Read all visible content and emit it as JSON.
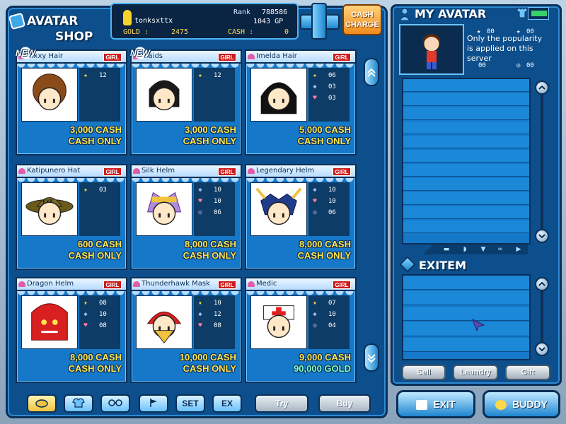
{
  "shop": {
    "title_line1": "AVATAR",
    "title_line2": "SHOP"
  },
  "info_bar": {
    "username": "tonksxttx",
    "rank_label": "Rank",
    "rank_value": "788586",
    "gp_value": "1043 GP",
    "gold_label": "GOLD :",
    "gold_value": "2475",
    "cash_label": "CASH :",
    "cash_value": "0"
  },
  "cash_charge": {
    "label_line1": "CASH",
    "label_line2": "CHARGE"
  },
  "items": [
    {
      "name": "...xxy Hair",
      "tag": "GIRL",
      "new": true,
      "stats": [
        {
          "icon": "star",
          "value": "12"
        }
      ],
      "price1": "3,000 CASH",
      "price2": "CASH ONLY"
    },
    {
      "name": "...aids",
      "tag": "GIRL",
      "new": true,
      "stats": [
        {
          "icon": "star",
          "value": "12"
        }
      ],
      "price1": "3,000 CASH",
      "price2": "CASH ONLY"
    },
    {
      "name": "Imelda Hair",
      "tag": "GIRL",
      "new": false,
      "stats": [
        {
          "icon": "star",
          "value": "06"
        },
        {
          "icon": "shield",
          "value": "03"
        },
        {
          "icon": "heart",
          "value": "03"
        }
      ],
      "price1": "5,000 CASH",
      "price2": "CASH ONLY"
    },
    {
      "name": "Katipunero Hat",
      "tag": "GIRL",
      "new": false,
      "stats": [
        {
          "icon": "star",
          "value": "03"
        }
      ],
      "price1": "600 CASH",
      "price2": "CASH ONLY"
    },
    {
      "name": "Silk Helm",
      "tag": "GIRL",
      "new": false,
      "stats": [
        {
          "icon": "shield",
          "value": "10"
        },
        {
          "icon": "heart",
          "value": "10"
        },
        {
          "icon": "swirl",
          "value": "06"
        }
      ],
      "price1": "8,000 CASH",
      "price2": "CASH ONLY"
    },
    {
      "name": "Legendary Helm",
      "tag": "GIRL",
      "new": false,
      "stats": [
        {
          "icon": "shield",
          "value": "10"
        },
        {
          "icon": "heart",
          "value": "10"
        },
        {
          "icon": "swirl",
          "value": "06"
        }
      ],
      "price1": "8,000 CASH",
      "price2": "CASH ONLY"
    },
    {
      "name": "Dragon Helm",
      "tag": "GIRL",
      "new": false,
      "stats": [
        {
          "icon": "star",
          "value": "08"
        },
        {
          "icon": "shield",
          "value": "10"
        },
        {
          "icon": "heart",
          "value": "08"
        }
      ],
      "price1": "8,000 CASH",
      "price2": "CASH ONLY"
    },
    {
      "name": "Thunderhawk Mask",
      "tag": "GIRL",
      "new": false,
      "stats": [
        {
          "icon": "star",
          "value": "10"
        },
        {
          "icon": "shield",
          "value": "12"
        },
        {
          "icon": "heart",
          "value": "08"
        }
      ],
      "price1": "10,000 CASH",
      "price2": "CASH ONLY"
    },
    {
      "name": "Medic",
      "tag": "GIRL",
      "new": false,
      "stats": [
        {
          "icon": "star",
          "value": "07"
        },
        {
          "icon": "shield",
          "value": "10"
        },
        {
          "icon": "swirl",
          "value": "04"
        }
      ],
      "price1": "9,000 CASH",
      "price2": "90,000 GOLD"
    }
  ],
  "new_label": "NEW",
  "toolbar": {
    "set_label": "SET",
    "ex_label": "EX",
    "try_label": "Try",
    "buy_label": "Buy"
  },
  "my_avatar": {
    "title": "MY AVATAR",
    "note": "Only the popularity is applied on this server",
    "mini_stat_value": "00"
  },
  "exitem": {
    "title": "EXITEM"
  },
  "actions": {
    "sell_label": "Sell",
    "laundry_label": "Laundry",
    "gift_label": "Gift",
    "exit_label": "EXIT",
    "buddy_label": "BUDDY"
  },
  "colors": {
    "panel": "#0d4f8c",
    "card": "#1578c9",
    "price": "#ffe34d",
    "gold_price": "#7effc6",
    "girl_tag": "#d01a1a"
  }
}
